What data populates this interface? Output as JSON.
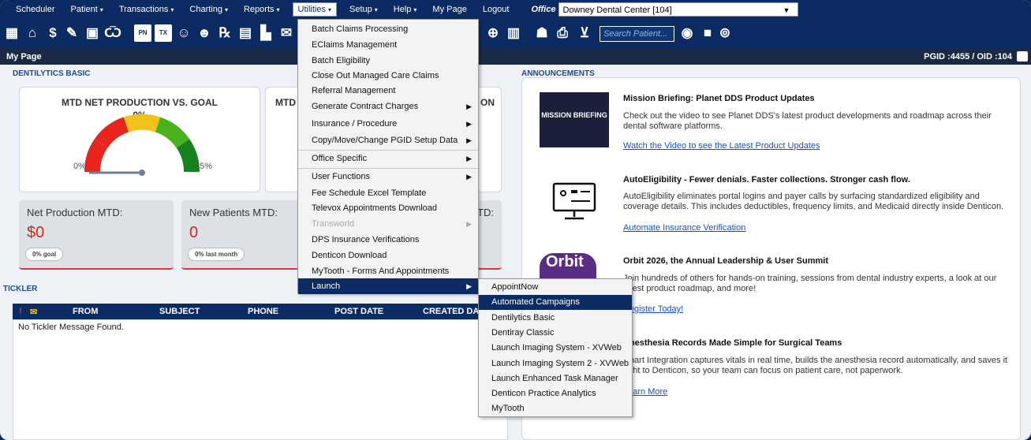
{
  "menubar": {
    "items": [
      {
        "label": "Scheduler",
        "caret": ""
      },
      {
        "label": "Patient",
        "caret": "▾"
      },
      {
        "label": "Transactions",
        "caret": "▾"
      },
      {
        "label": "Charting",
        "caret": "▾"
      },
      {
        "label": "Reports",
        "caret": "▾"
      },
      {
        "label": "Utilities",
        "caret": "▾"
      },
      {
        "label": "Setup",
        "caret": "▾"
      },
      {
        "label": "Help",
        "caret": "▾"
      },
      {
        "label": "My Page",
        "caret": ""
      },
      {
        "label": "Logout",
        "caret": ""
      }
    ],
    "office_label": "Office",
    "office_value": "Downey Dental Center [104]"
  },
  "toolbar": {
    "search_placeholder": "Search Patient...",
    "icons": [
      "calendar-icon",
      "home-icon",
      "dollar-icon",
      "pen-icon",
      "tooth-icon",
      "tooth-outline-icon",
      "pn-icon",
      "tx-icon",
      "users-add-icon",
      "users-remove-icon",
      "rx-icon",
      "message-icon",
      "document-icon",
      "globe-icon",
      "chart-icon",
      "family-icon",
      "printer-icon",
      "collapse-icon",
      "search-patient-icon",
      "square-icon",
      "find-icon"
    ]
  },
  "mypage": {
    "title": "My Page",
    "pgid": "PGID :4455 / OID :104"
  },
  "dentilytics": {
    "section_title": "DENTILYTICS BASIC",
    "gauge1": {
      "title": "MTD NET PRODUCTION VS. GOAL",
      "pct": "0%",
      "min_label": "0%",
      "max_label": "25%"
    },
    "gauge2_title_fragment": "MTD",
    "gauge2_pct_fragment": "ON",
    "stats": [
      {
        "label": "Net Production MTD:",
        "value": "$0",
        "pill": "0% goal"
      },
      {
        "label": "New Patients MTD:",
        "value": "0",
        "pill": "0% last month"
      }
    ],
    "stat3_fragment": "TD:"
  },
  "tickler": {
    "section_title": "TICKLER",
    "columns": [
      "FROM",
      "SUBJECT",
      "PHONE",
      "POST DATE",
      "CREATED DAT"
    ],
    "empty_message": "No Tickler Message Found."
  },
  "announcements": {
    "section_title": "ANNOUNCEMENTS",
    "items": [
      {
        "title": "Mission Briefing: Planet DDS Product Updates",
        "text": "Check out the video to see Planet DDS's latest product developments and roadmap across their dental software platforms.",
        "link": "Watch the Video to see the Latest Product Updates",
        "thumb_text": "MISSION BRIEFING"
      },
      {
        "title": "AutoEligibility - Fewer denials. Faster collections. Stronger cash flow.",
        "text": "AutoEligibility eliminates portal logins and payer calls by surfacing standardized eligibility and coverage details. This includes deductibles, frequency limits, and Medicaid directly inside Denticon.",
        "link": "Automate Insurance Verification"
      },
      {
        "title": "Orbit 2026, the Annual Leadership & User Summit",
        "text": "Join hundreds of others for hands-on training, sessions from dental industry experts, a look at our latest product roadmap, and more!",
        "link": "Register Today!",
        "thumb_text": "Orbit"
      },
      {
        "title": "Anesthesia Records Made Simple for Surgical Teams",
        "text": "Chart Integration captures vitals in real time, builds the anesthesia record automatically, and saves it right to Denticon, so your team can focus on patient care, not paperwork.",
        "link": "Learn More"
      }
    ]
  },
  "utilities_menu": [
    {
      "label": "Batch Claims Processing",
      "sub": false,
      "disabled": false,
      "sep": false
    },
    {
      "label": "EClaims Management",
      "sub": false,
      "disabled": false,
      "sep": false
    },
    {
      "label": "Batch Eligibility",
      "sub": false,
      "disabled": false,
      "sep": false
    },
    {
      "label": "Close Out Managed Care Claims",
      "sub": false,
      "disabled": false,
      "sep": false
    },
    {
      "label": "Referral Management",
      "sub": false,
      "disabled": false,
      "sep": false
    },
    {
      "label": "Generate Contract Charges",
      "sub": true,
      "disabled": false,
      "sep": false
    },
    {
      "label": "Insurance / Procedure",
      "sub": true,
      "disabled": false,
      "sep": false
    },
    {
      "label": "Copy/Move/Change PGID Setup Data",
      "sub": true,
      "disabled": false,
      "sep": false
    },
    {
      "label": "Office Specific",
      "sub": true,
      "disabled": false,
      "sep": true
    },
    {
      "label": "User Functions",
      "sub": true,
      "disabled": false,
      "sep": true
    },
    {
      "label": "Fee Schedule Excel Template",
      "sub": false,
      "disabled": false,
      "sep": false
    },
    {
      "label": "Televox Appointments Download",
      "sub": false,
      "disabled": false,
      "sep": false
    },
    {
      "label": "Transworld",
      "sub": true,
      "disabled": true,
      "sep": false
    },
    {
      "label": "DPS Insurance Verifications",
      "sub": false,
      "disabled": false,
      "sep": false
    },
    {
      "label": "Denticon Download",
      "sub": false,
      "disabled": false,
      "sep": false
    },
    {
      "label": "MyTooth - Forms And Appointments",
      "sub": false,
      "disabled": false,
      "sep": false
    },
    {
      "label": "Launch",
      "sub": true,
      "disabled": false,
      "sep": false,
      "selected": true
    }
  ],
  "launch_menu": [
    {
      "label": "AppointNow"
    },
    {
      "label": "Automated Campaigns",
      "selected": true
    },
    {
      "label": "Dentilytics Basic"
    },
    {
      "label": "Dentiray Classic"
    },
    {
      "label": "Launch Imaging System - XVWeb"
    },
    {
      "label": "Launch Imaging System 2 - XVWeb"
    },
    {
      "label": "Launch Enhanced Task Manager"
    },
    {
      "label": "Denticon Practice Analytics"
    },
    {
      "label": "MyTooth"
    }
  ],
  "submenu_arrow": "▶",
  "colors": {
    "navy": "#0d2b63",
    "accent_red": "#d9261c",
    "link": "#1b4fc4"
  }
}
